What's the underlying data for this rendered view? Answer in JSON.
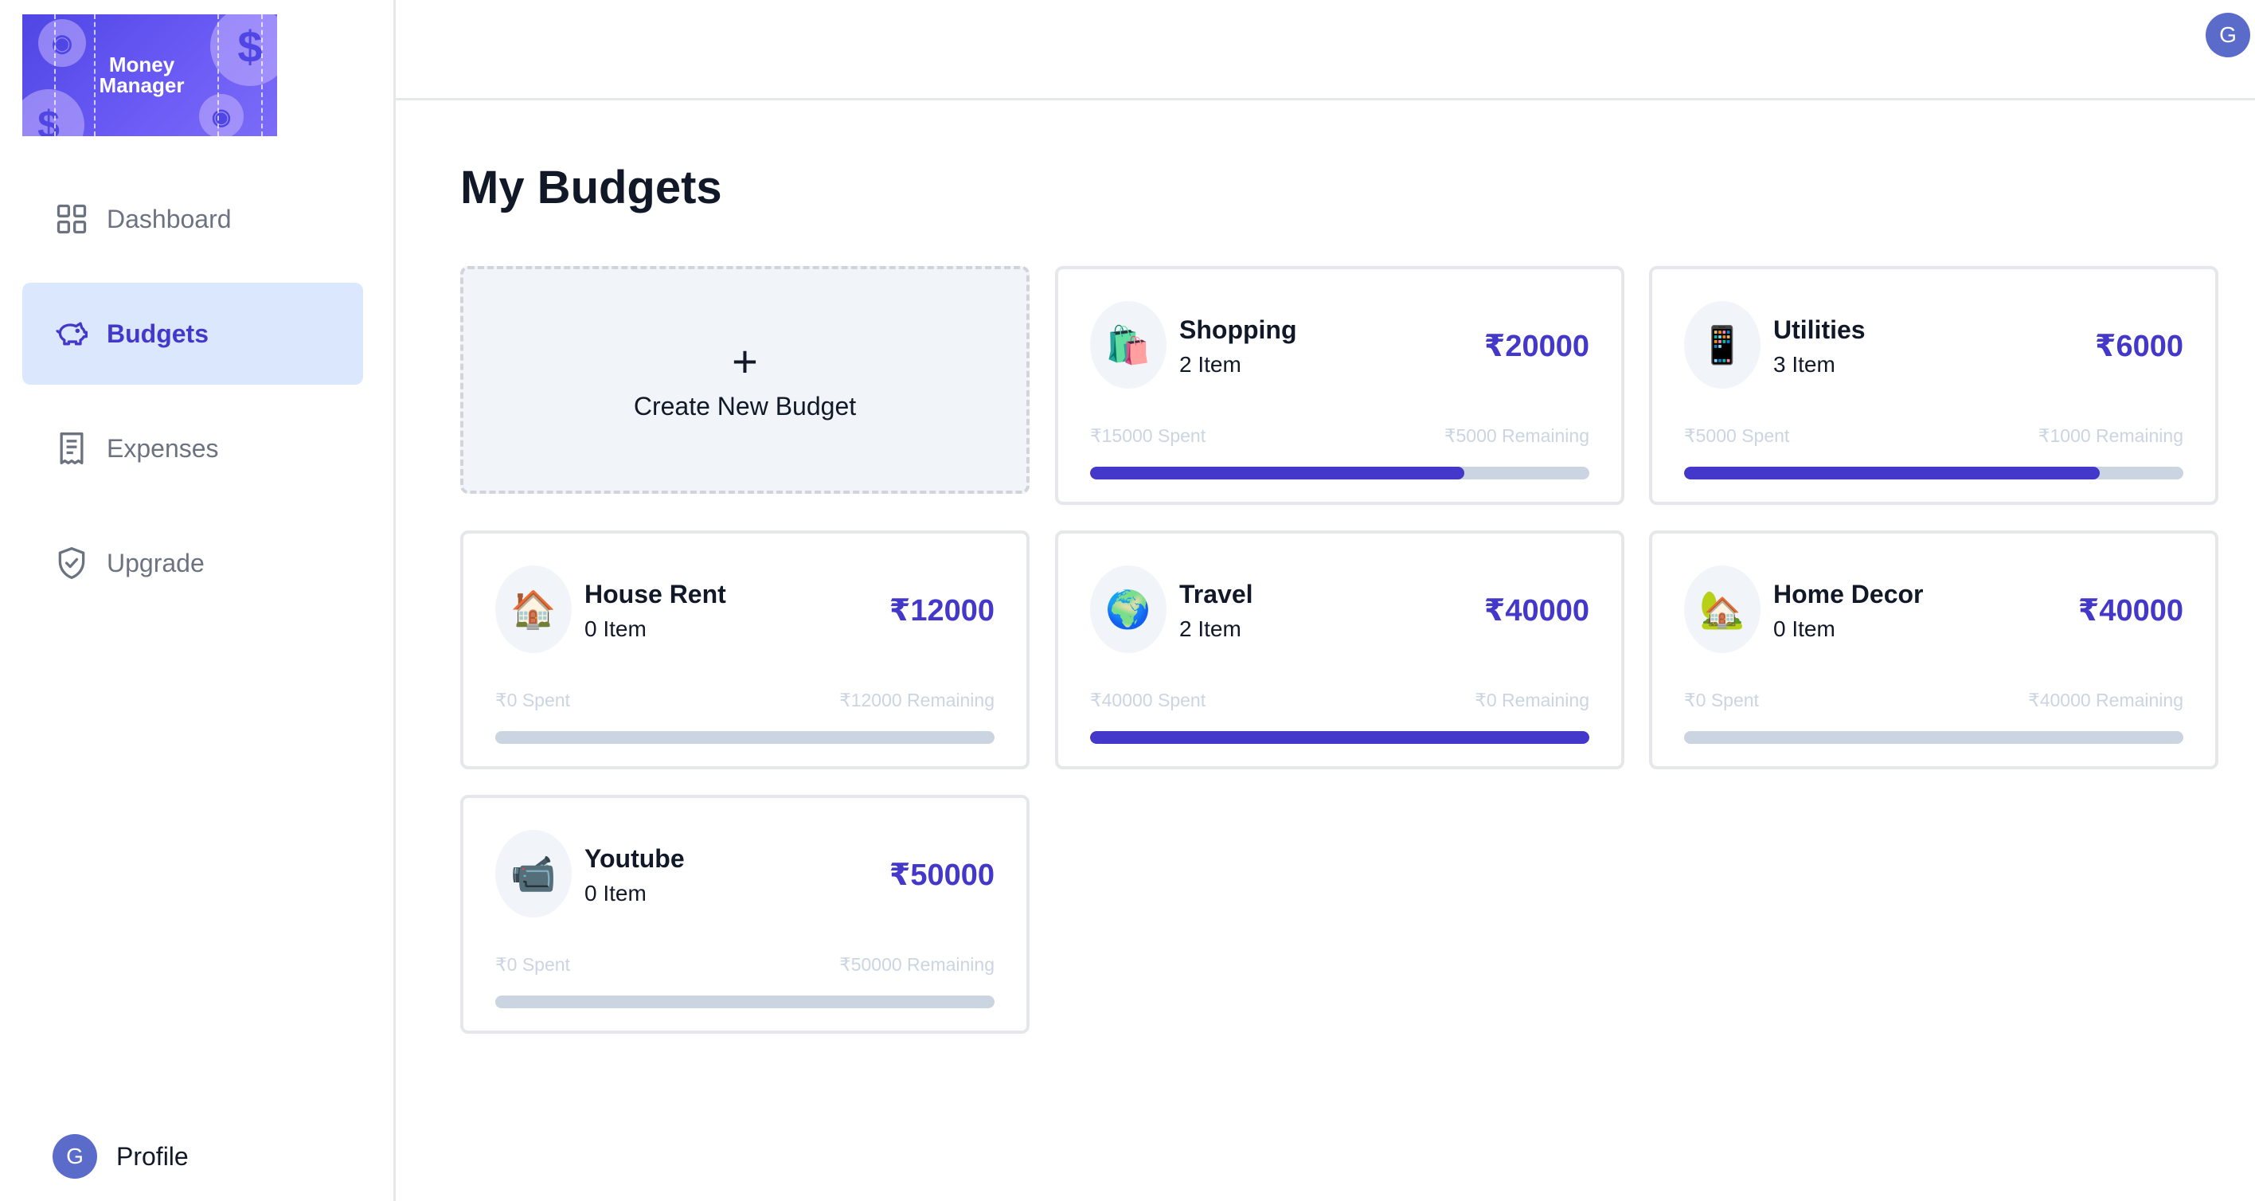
{
  "app": {
    "logo_text_line1": "Money",
    "logo_text_line2": "Manager",
    "brand_color": "#4f46e5",
    "accent_color": "#4338ca"
  },
  "sidebar": {
    "items": [
      {
        "label": "Dashboard",
        "icon": "grid-icon",
        "active": false
      },
      {
        "label": "Budgets",
        "icon": "piggy-bank-icon",
        "active": true
      },
      {
        "label": "Expenses",
        "icon": "receipt-icon",
        "active": false
      },
      {
        "label": "Upgrade",
        "icon": "shield-check-icon",
        "active": false
      }
    ],
    "profile": {
      "initial": "G",
      "label": "Profile"
    }
  },
  "header": {
    "avatar_initial": "G"
  },
  "main": {
    "title": "My Budgets",
    "create_card": {
      "plus": "+",
      "label": "Create New Budget"
    },
    "budgets": [
      {
        "emoji": "🛍️",
        "name": "Shopping",
        "items": "2 Item",
        "amount": "₹20000",
        "spent": "₹15000 Spent",
        "remaining": "₹5000 Remaining",
        "progress": 0.75
      },
      {
        "emoji": "📱",
        "name": "Utilities",
        "items": "3 Item",
        "amount": "₹6000",
        "spent": "₹5000 Spent",
        "remaining": "₹1000 Remaining",
        "progress": 0.833
      },
      {
        "emoji": "🏠",
        "name": "House Rent",
        "items": "0 Item",
        "amount": "₹12000",
        "spent": "₹0 Spent",
        "remaining": "₹12000 Remaining",
        "progress": 0
      },
      {
        "emoji": "🌍",
        "name": "Travel",
        "items": "2 Item",
        "amount": "₹40000",
        "spent": "₹40000 Spent",
        "remaining": "₹0 Remaining",
        "progress": 1
      },
      {
        "emoji": "🏡",
        "name": "Home Decor",
        "items": "0 Item",
        "amount": "₹40000",
        "spent": "₹0 Spent",
        "remaining": "₹40000 Remaining",
        "progress": 0
      },
      {
        "emoji": "📹",
        "name": "Youtube",
        "items": "0 Item",
        "amount": "₹50000",
        "spent": "₹0 Spent",
        "remaining": "₹50000 Remaining",
        "progress": 0
      }
    ]
  }
}
